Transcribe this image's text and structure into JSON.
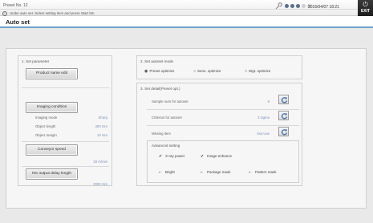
{
  "header": {
    "preset_label": "Preset No. 12",
    "guide_text": "Under auto set. Select setting item and press Start btn",
    "datetime": "2016/04/07  18:21",
    "exit_label": "EXIT",
    "status_dots": [
      "on",
      "on",
      "on",
      "off",
      "off"
    ]
  },
  "page": {
    "title": "Auto set"
  },
  "set_parameter": {
    "title": "1. Set parameter",
    "product_name_edit": "Product name edit",
    "imaging_condition": "Imaging condition",
    "rows": [
      {
        "label": "Imaging mode",
        "value": "Sharp"
      },
      {
        "label": "Object length",
        "value": "300 mm"
      },
      {
        "label": "Object margin",
        "value": "10 mm"
      }
    ],
    "conveyor_speed": "Conveyor speed",
    "conveyor_speed_value": "20 m/min",
    "ng_output_delay": "NG output delay length",
    "ng_output_delay_value": "2000 mm"
  },
  "autoset_mode": {
    "title": "2. Set autoset mode",
    "options": [
      "Preset optimize",
      "Sens. optimize",
      "Wgt. optimize"
    ],
    "selected_index": 0
  },
  "detail": {
    "title": "3. Set detail(Preset opt.)",
    "sample_num_label": "Sample num for autoset",
    "sample_num_value": "5",
    "criterion_label": "Criterion for autoset",
    "criterion_value": "3 sigma",
    "missing_item_label": "Missing item",
    "missing_item_value": "Not Use",
    "advanced_title": "Advanced setting",
    "checkboxes": [
      {
        "label": "X-ray power",
        "checked": true
      },
      {
        "label": "Image enhance",
        "checked": true
      },
      {
        "label": "Bright",
        "checked": false
      },
      {
        "label": "Package mask",
        "checked": false
      },
      {
        "label": "Pattern mask",
        "checked": false
      }
    ]
  },
  "colors": {
    "accent": "#6fa3cf",
    "value_text": "#7b93b8",
    "status_dot_on": "#5a6e8e",
    "status_dot_off": "#cfcfcf",
    "exit_bg": "#2a2a2a"
  },
  "icons": {
    "info": "info-icon",
    "wrench": "wrench-icon",
    "exit": "power-icon",
    "refresh": "refresh-icon"
  }
}
